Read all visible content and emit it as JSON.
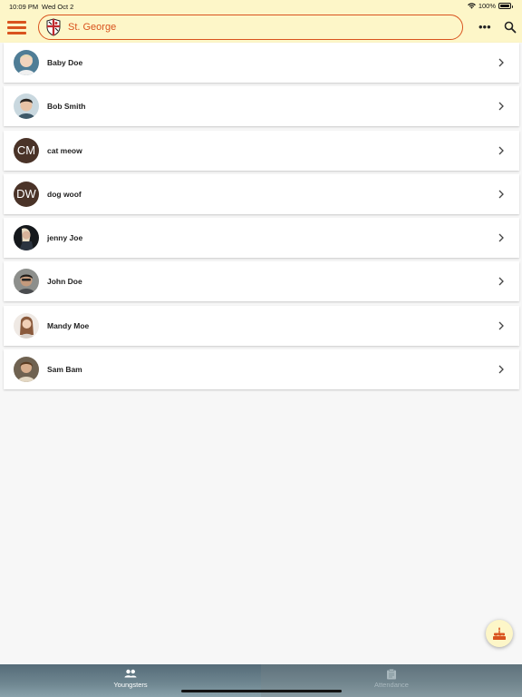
{
  "status_bar": {
    "time": "10:09 PM",
    "date": "Wed Oct 2",
    "battery": "100%"
  },
  "header": {
    "school_name": "St. George"
  },
  "colors": {
    "accent": "#d9531e",
    "header_bg": "#fdf6c8",
    "initials_bg": "#4a3328"
  },
  "youngsters": [
    {
      "name": "Baby Doe",
      "avatar": "photo"
    },
    {
      "name": "Bob Smith",
      "avatar": "photo"
    },
    {
      "name": "cat meow",
      "avatar": "initials",
      "initials": "CM"
    },
    {
      "name": "dog woof",
      "avatar": "initials",
      "initials": "DW"
    },
    {
      "name": "jenny Joe",
      "avatar": "photo"
    },
    {
      "name": "John Doe",
      "avatar": "photo"
    },
    {
      "name": "Mandy Moe",
      "avatar": "photo"
    },
    {
      "name": "Sam Bam",
      "avatar": "photo"
    }
  ],
  "tabs": [
    {
      "label": "Youngsters",
      "icon": "people-icon",
      "active": true
    },
    {
      "label": "Attendance",
      "icon": "clipboard-icon",
      "active": false
    }
  ],
  "fab": {
    "icon": "birthday-cake-icon"
  }
}
